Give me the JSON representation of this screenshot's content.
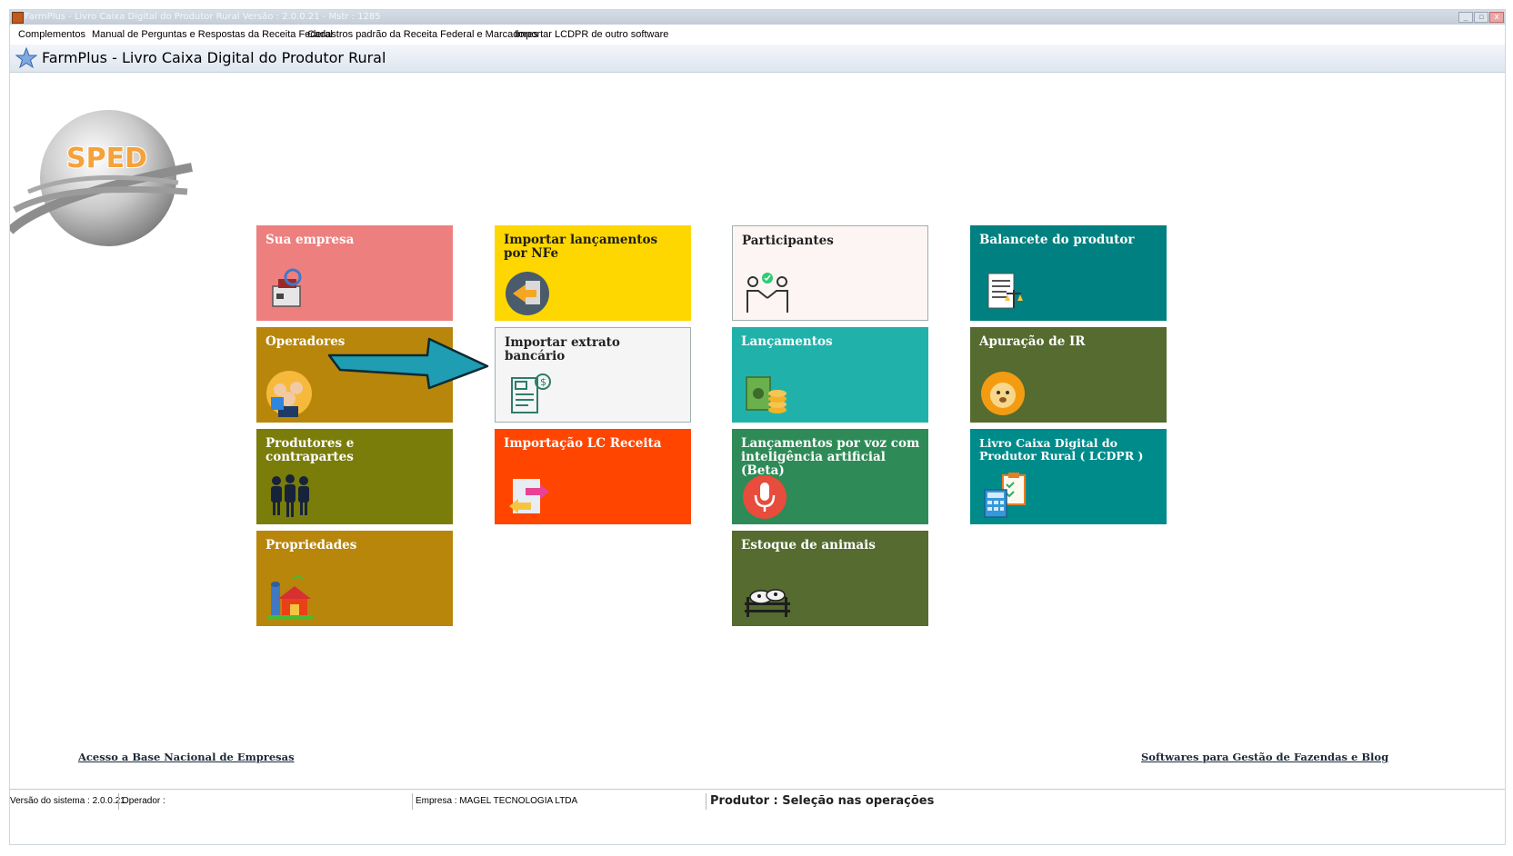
{
  "window": {
    "title": "FarmPlus - Livro Caixa Digital do Produtor Rural Versão : 2.0.0.21 - Mstr : 1285",
    "controls": [
      "_",
      "▫",
      "x"
    ]
  },
  "menu": {
    "items": [
      "Complementos",
      "Manual de Perguntas e Respostas da Receita Federal",
      "Cadastros padrão da Receita Federal e Marcadores",
      "Importar LCDPR de outro software"
    ]
  },
  "header": {
    "title": "FarmPlus - Livro Caixa Digital do Produtor Rural"
  },
  "logo": {
    "text": "SPED"
  },
  "tiles": {
    "sua_empresa": {
      "label": "Sua empresa",
      "color": "#ee7f7f",
      "icon": "office-machine-icon"
    },
    "operadores": {
      "label": "Operadores",
      "color": "#b8860b",
      "icon": "operators-icon"
    },
    "produtores": {
      "label": "Produtores e contrapartes",
      "color": "#7a7d0a",
      "icon": "people-icon"
    },
    "propriedades": {
      "label": "Propriedades",
      "color": "#b8860b",
      "icon": "farm-icon"
    },
    "importar_nfe": {
      "label": "Importar lançamentos por NFe",
      "color": "#ffd700",
      "icon": "import-arrow-icon"
    },
    "importar_extrato": {
      "label": "Importar extrato bancário",
      "color": "#f4f5f4",
      "icon": "bank-statement-icon"
    },
    "importacao_lc": {
      "label": "Importação LC Receita",
      "color": "#ff4500",
      "icon": "file-exchange-icon"
    },
    "participantes": {
      "label": "Participantes",
      "color": "#fdf5f4",
      "icon": "handshake-icon"
    },
    "lancamentos": {
      "label": "Lançamentos",
      "color": "#20b2aa",
      "icon": "money-coins-icon"
    },
    "lancamentos_voz": {
      "label": "Lançamentos por voz com inteligência artificial (Beta)",
      "color": "#2e8b57",
      "icon": "microphone-icon"
    },
    "estoque_animais": {
      "label": "Estoque de animais",
      "color": "#556b2f",
      "icon": "cattle-icon"
    },
    "balancete": {
      "label": "Balancete do produtor",
      "color": "#008080",
      "icon": "balance-report-icon"
    },
    "apuracao_ir": {
      "label": "Apuração de IR",
      "color": "#556b2f",
      "icon": "lion-icon"
    },
    "lcdpr": {
      "label": "Livro Caixa Digital do Produtor Rural ( LCDPR )",
      "color": "#008b8b",
      "icon": "calculator-checklist-icon"
    }
  },
  "links": {
    "base_nacional": "Acesso a Base Nacional de Empresas",
    "softwares": "Softwares para Gestão de Fazendas e Blog"
  },
  "status": {
    "versao": "Versão do sistema : 2.0.0.21",
    "operador": "Operador :",
    "empresa": "Empresa : MAGEL TECNOLOGIA LTDA",
    "produtor": "Produtor : Seleção nas operações"
  }
}
